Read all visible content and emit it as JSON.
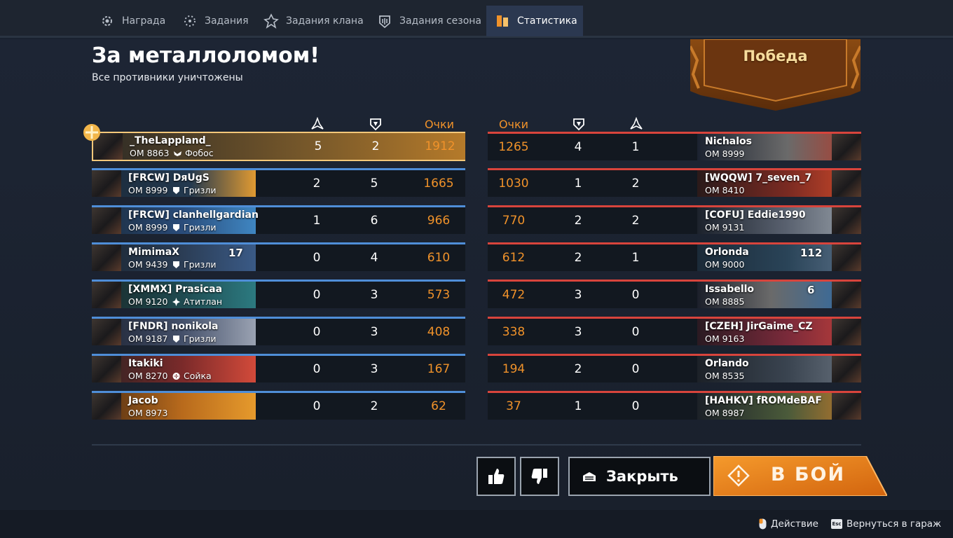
{
  "tabs": [
    {
      "label": "Награда",
      "icon": "reward-gear-icon"
    },
    {
      "label": "Задания",
      "icon": "missions-gear-icon"
    },
    {
      "label": "Задания клана",
      "icon": "clan-missions-icon"
    },
    {
      "label": "Задания сезона",
      "icon": "season-missions-icon"
    },
    {
      "label": "Статистика",
      "icon": "statistics-icon",
      "active": true
    }
  ],
  "battle": {
    "title": "За металлоломом!",
    "subtitle": "Все противники уничтожены",
    "result": "Победа"
  },
  "headers": {
    "score": "Очки",
    "assists_icon": "assists-icon",
    "kills_icon": "kills-shield-icon"
  },
  "left_team": [
    {
      "name": "_TheLappland_",
      "om": "ОМ 8863",
      "clan": "Фобос",
      "clan_icon": "wings-icon",
      "assists": "5",
      "kills": "2",
      "score": "1912",
      "me": true
    },
    {
      "name": "[FRCW] DяUgS",
      "om": "ОМ 8999",
      "clan": "Гризли",
      "clan_icon": "grizzly-shield-icon",
      "assists": "2",
      "kills": "5",
      "score": "1665"
    },
    {
      "name": "[FRCW] clanhellgardian",
      "om": "ОМ 8999",
      "clan": "Гризли",
      "clan_icon": "grizzly-shield-icon",
      "assists": "1",
      "kills": "6",
      "score": "966"
    },
    {
      "name": "MimimaX",
      "om": "ОМ 9439",
      "clan": "Гризли",
      "clan_icon": "grizzly-shield-icon",
      "assists": "0",
      "kills": "4",
      "score": "610",
      "level": "17"
    },
    {
      "name": "[XMMX] Prasicaa",
      "om": "ОМ 9120",
      "clan": "Атитлан",
      "clan_icon": "atitlan-icon",
      "assists": "0",
      "kills": "3",
      "score": "573"
    },
    {
      "name": "[FNDR] nonikola",
      "om": "ОМ 9187",
      "clan": "Гризли",
      "clan_icon": "grizzly-shield-icon",
      "assists": "0",
      "kills": "3",
      "score": "408"
    },
    {
      "name": "Itakiki",
      "om": "ОМ 8270",
      "clan": "Сойка",
      "clan_icon": "jay-icon",
      "assists": "0",
      "kills": "3",
      "score": "167"
    },
    {
      "name": "Jacob",
      "om": "ОМ 8973",
      "clan": "",
      "clan_icon": "",
      "assists": "0",
      "kills": "2",
      "score": "62"
    }
  ],
  "right_team": [
    {
      "name": "Nichalos",
      "om": "ОМ 8999",
      "assists": "1",
      "kills": "4",
      "score": "1265"
    },
    {
      "name": "[WQQW] 7_seven_7",
      "om": "ОМ 8410",
      "assists": "2",
      "kills": "1",
      "score": "1030"
    },
    {
      "name": "[COFU] Eddie1990",
      "om": "ОМ 9131",
      "assists": "2",
      "kills": "2",
      "score": "770"
    },
    {
      "name": "Orlonda",
      "om": "ОМ 9000",
      "assists": "1",
      "kills": "2",
      "score": "612",
      "level": "112"
    },
    {
      "name": "Issabello",
      "om": "ОМ 8885",
      "assists": "0",
      "kills": "3",
      "score": "472",
      "level": "6"
    },
    {
      "name": "[CZEH] JirGaime_CZ",
      "om": "ОМ 9163",
      "assists": "0",
      "kills": "3",
      "score": "338"
    },
    {
      "name": "Orlando",
      "om": "ОМ 8535",
      "assists": "0",
      "kills": "2",
      "score": "194"
    },
    {
      "name": "[HAHKV] fROMdeBAF",
      "om": "ОМ 8987",
      "assists": "0",
      "kills": "1",
      "score": "37"
    }
  ],
  "buttons": {
    "like_icon": "thumbs-up-icon",
    "dislike_icon": "thumbs-down-icon",
    "close_label": "Закрыть",
    "close_icon": "garage-icon",
    "fight_label": "В БОЙ",
    "fight_icon": "alert-diamond-icon"
  },
  "hints": {
    "action_label": "Действие",
    "action_key": "mouse-icon",
    "back_label": "Вернуться в гараж",
    "back_key": "Esc"
  },
  "colors": {
    "accent_orange": "#f0922a",
    "ally_blue": "#4f8ed8",
    "enemy_red": "#d8443c",
    "me_gold": "#f4c87a"
  }
}
